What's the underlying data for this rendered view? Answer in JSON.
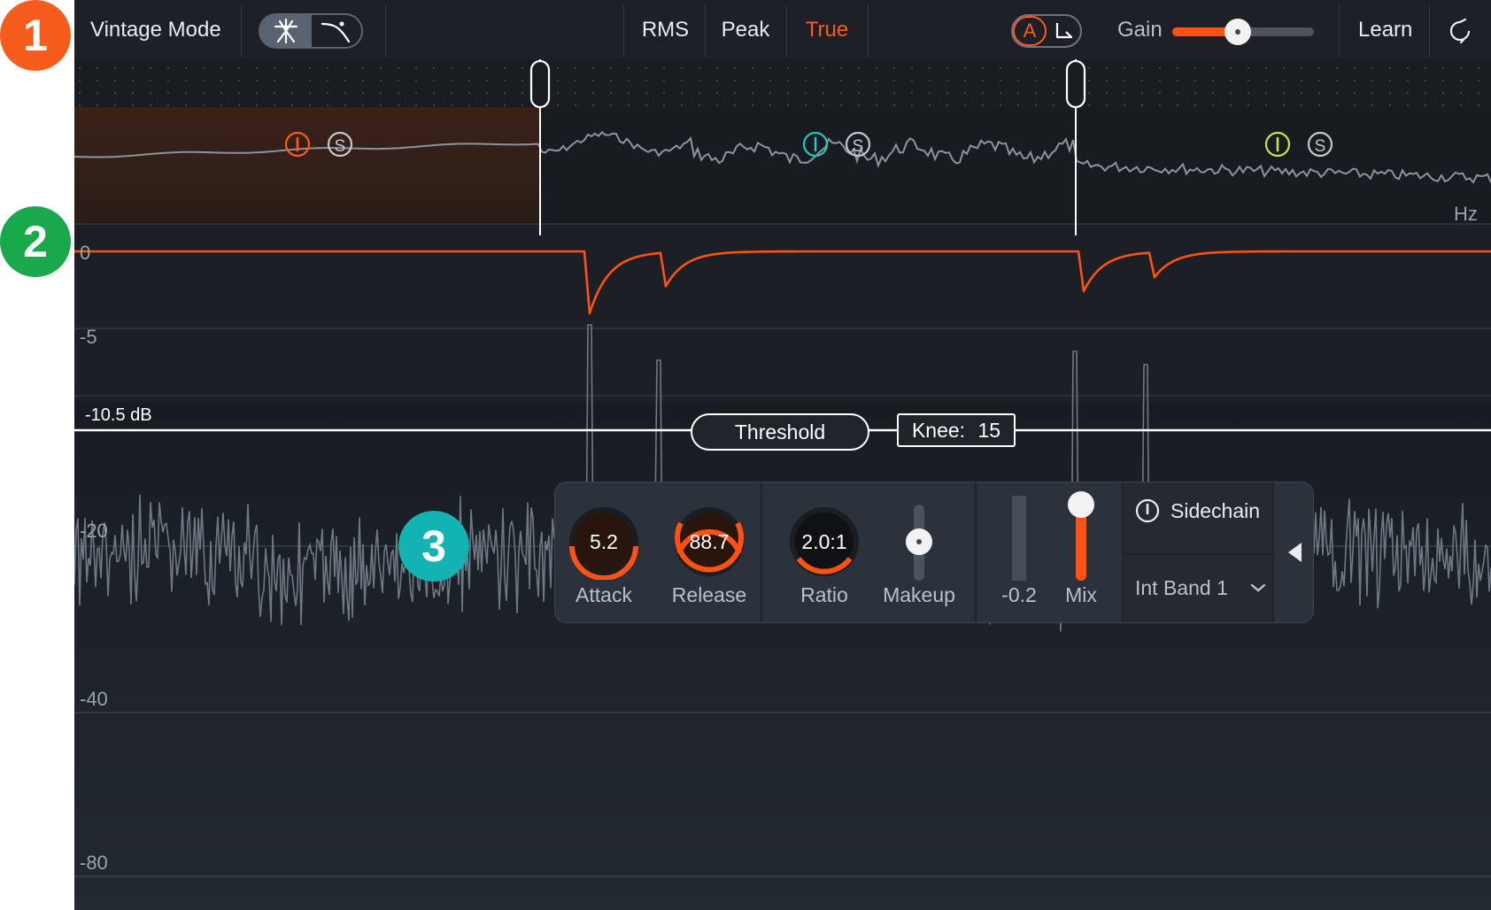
{
  "badges": [
    {
      "label": "1",
      "color": "#f65c1b"
    },
    {
      "label": "2",
      "color": "#19a84a"
    },
    {
      "label": "3",
      "color": "#14b3b3"
    }
  ],
  "toolbar": {
    "vintage_mode_label": "Vintage Mode",
    "detection_modes": [
      "RMS",
      "Peak",
      "True"
    ],
    "active_detection": "True",
    "ab_label": "A",
    "gain_label": "Gain",
    "gain_level": 0.46,
    "learn_label": "Learn"
  },
  "bands": [
    {
      "color": "#ff5a1a",
      "solo": "S"
    },
    {
      "color": "#22c6bd",
      "solo": "S"
    },
    {
      "color": "#c8e24a",
      "solo": "S"
    }
  ],
  "spectrum": {
    "unit_label": "Hz"
  },
  "gain_reduction": {
    "ticks": [
      "0",
      "-5"
    ]
  },
  "threshold": {
    "value_label": "-10.5 dB",
    "button_label": "Threshold",
    "knee_label": "Knee:",
    "knee_value": "15"
  },
  "meter_axis": [
    "-20",
    "-40",
    "-80"
  ],
  "controls": {
    "attack": {
      "value": "5.2",
      "label": "Attack"
    },
    "release": {
      "value": "88.7",
      "label": "Release"
    },
    "ratio": {
      "value": "2.0:1",
      "label": "Ratio"
    },
    "makeup": {
      "label": "Makeup"
    },
    "meter_value": "-0.2",
    "mix": {
      "label": "Mix",
      "level": 0.9
    },
    "sidechain_label": "Sidechain",
    "band_select": "Int Band 1"
  },
  "colors": {
    "accent": "#ff5212",
    "background": "#1f242b",
    "toolbar": "#1d2127"
  }
}
